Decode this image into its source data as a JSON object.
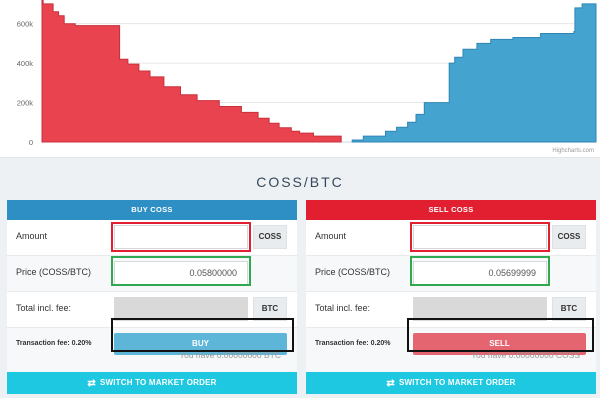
{
  "chart": {
    "y_ticks": [
      "600k",
      "400k",
      "200k",
      "0"
    ],
    "credit": "Highcharts.com",
    "colors": {
      "bids": "#e8434f",
      "asks": "#45a3d0"
    }
  },
  "chart_data": {
    "type": "area",
    "title": "",
    "xlabel": "",
    "ylabel": "",
    "ylim": [
      0,
      720000
    ],
    "y_tick_values": [
      0,
      200000,
      400000,
      600000
    ],
    "series": [
      {
        "name": "",
        "x": [
          0,
          0.2,
          2.0,
          3.0,
          4.0,
          6.0,
          14.0,
          15.5,
          17.5,
          19.5,
          22.0,
          25.0,
          28.0,
          32.0,
          36.0,
          39.0,
          41.0,
          42.8,
          45.0,
          46.5,
          49.0,
          54.0
        ],
        "values": [
          720000,
          700000,
          660000,
          640000,
          600000,
          590000,
          420000,
          395000,
          360000,
          330000,
          280000,
          240000,
          210000,
          180000,
          150000,
          120000,
          95000,
          72000,
          55000,
          45000,
          30000,
          10000
        ]
      },
      {
        "name": "",
        "x": [
          56.0,
          58.0,
          62.0,
          64.0,
          66.0,
          67.5,
          69.0,
          73.5,
          74.5,
          76.0,
          78.5,
          81.0,
          85.0,
          90.0,
          96.0,
          96.2,
          97.5,
          99.7
        ],
        "values": [
          10000,
          30000,
          55000,
          75000,
          100000,
          140000,
          200000,
          400000,
          430000,
          470000,
          500000,
          520000,
          530000,
          550000,
          560000,
          680000,
          700000,
          700000
        ]
      }
    ]
  },
  "pair": {
    "title": "COSS/BTC"
  },
  "buy": {
    "header": "BUY COSS",
    "amount_label": "Amount",
    "amount_value": "",
    "amount_unit": "COSS",
    "price_label": "Price (COSS/BTC)",
    "price_value": "0.05800000",
    "total_label": "Total incl. fee:",
    "total_unit": "BTC",
    "fee_label": "Transaction fee: 0.20%",
    "action_label": "BUY",
    "balance": "You have 0.00000000 BTC",
    "market_label": "SWITCH TO MARKET ORDER"
  },
  "sell": {
    "header": "SELL COSS",
    "amount_label": "Amount",
    "amount_value": "",
    "amount_unit": "COSS",
    "price_label": "Price (COSS/BTC)",
    "price_value": "0.05699999",
    "total_label": "Total incl. fee:",
    "total_unit": "BTC",
    "fee_label": "Transaction fee: 0.20%",
    "action_label": "SELL",
    "balance": "You have 0.00000000 COSS",
    "market_label": "SWITCH TO MARKET ORDER"
  }
}
